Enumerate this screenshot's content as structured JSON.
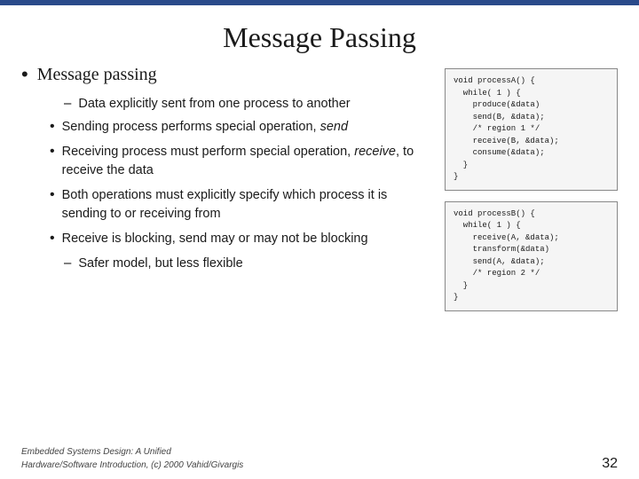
{
  "slide": {
    "title": "Message Passing",
    "top_bar_color": "#2a4a8a",
    "main_bullet": "Message passing",
    "sub_items": [
      {
        "type": "dash",
        "text": "Data explicitly sent from one process to another"
      },
      {
        "type": "bullet",
        "text": "Sending process performs special operation, send"
      },
      {
        "type": "bullet",
        "text": "Receiving process must perform special operation, receive, to receive the data"
      },
      {
        "type": "bullet",
        "text": "Both operations must explicitly specify which process it is sending to or receiving from"
      },
      {
        "type": "bullet",
        "text": "Receive is blocking, send may or may not be blocking"
      },
      {
        "type": "dash",
        "text": "Safer model, but less flexible"
      }
    ],
    "code_box_a": "void processA() {\n  while( 1 ) {\n    produce(&data)\n    send(B, &data);\n    /* region 1 */\n    receive(B, &data);\n    consume(&data);\n  }\n}",
    "code_box_b": "void processB() {\n  while( 1 ) {\n    receive(A, &data);\n    transform(&data)\n    send(A, &data);\n    /* region 2 */\n  }\n}",
    "footer_left_line1": "Embedded Systems Design: A Unified",
    "footer_left_line2": "Hardware/Software Introduction, (c) 2000 Vahid/Givargis",
    "footer_right": "32"
  }
}
